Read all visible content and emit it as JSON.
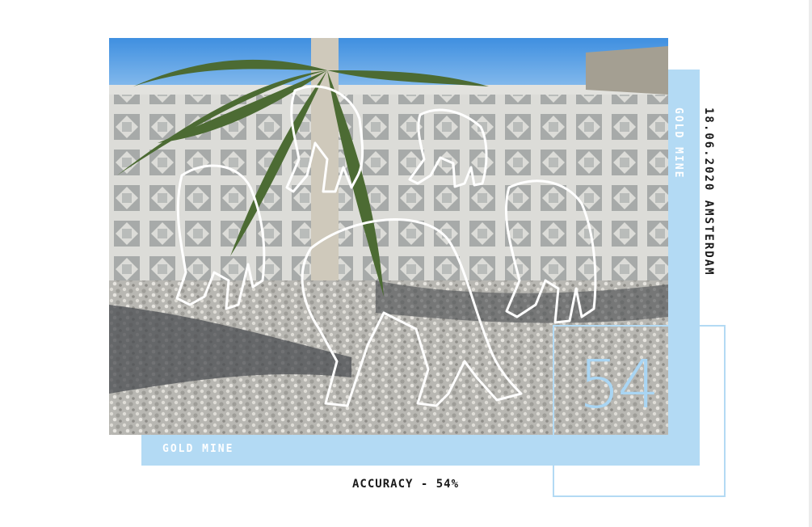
{
  "band": {
    "label": "GOLD MINE",
    "vertical_label": "GOLD MINE",
    "date_location": "18.06.2020 AMSTERDAM"
  },
  "score": {
    "value": "54"
  },
  "caption": "ACCURACY - 54%",
  "colors": {
    "accent": "#b3daf4",
    "number": "#a9d5f3",
    "text": "#1a1a1a",
    "background": "#ffffff"
  },
  "icons": {
    "figures": "human-figure-outlines"
  }
}
